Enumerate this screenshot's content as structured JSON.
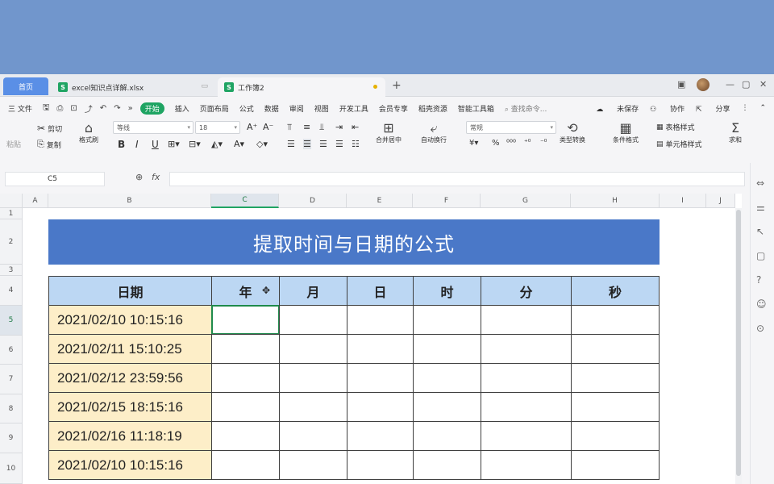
{
  "tabs": {
    "home": "首页",
    "doc1": "excel知识点详解.xlsx",
    "doc2": "工作簿2",
    "doc1_icon": "S",
    "doc2_icon": "S"
  },
  "menu": {
    "file": "三 文件",
    "items": [
      "开始",
      "插入",
      "页面布局",
      "公式",
      "数据",
      "审阅",
      "视图",
      "开发工具",
      "会员专享",
      "稻壳资源",
      "智能工具箱"
    ],
    "search": "查找命令...",
    "unsaved": "未保存",
    "collab": "协作",
    "share": "分享"
  },
  "ribbon": {
    "cut": "剪切",
    "paste": "粘贴",
    "copy": "复制",
    "format_painter": "格式刷",
    "font_name": "等线",
    "font_size": "18",
    "merge": "合并居中",
    "wrap": "自动换行",
    "number_format": "常规",
    "type_convert": "类型转换",
    "cond_format": "条件格式",
    "table_style": "表格样式",
    "cell_style": "单元格样式",
    "sum": "求和"
  },
  "formula_bar": {
    "cell_ref": "C5",
    "fx": "fx",
    "value": ""
  },
  "columns": [
    "A",
    "B",
    "C",
    "D",
    "E",
    "F",
    "G",
    "H",
    "I",
    "J"
  ],
  "rows": [
    "1",
    "2",
    "3",
    "4",
    "5",
    "6",
    "7",
    "8",
    "9",
    "10"
  ],
  "sheet": {
    "title": "提取时间与日期的公式",
    "headers": [
      "日期",
      "年",
      "月",
      "日",
      "时",
      "分",
      "秒"
    ],
    "dates": [
      "2021/02/10 10:15:16",
      "2021/02/11 15:10:25",
      "2021/02/12 23:59:56",
      "2021/02/15 18:15:16",
      "2021/02/16 11:18:19",
      "2021/02/10 10:15:16"
    ]
  },
  "colors": {
    "title_band": "#4a78c8",
    "header_fill": "#bcd7f3",
    "date_fill": "#fdeec8",
    "accent": "#1fa463"
  }
}
